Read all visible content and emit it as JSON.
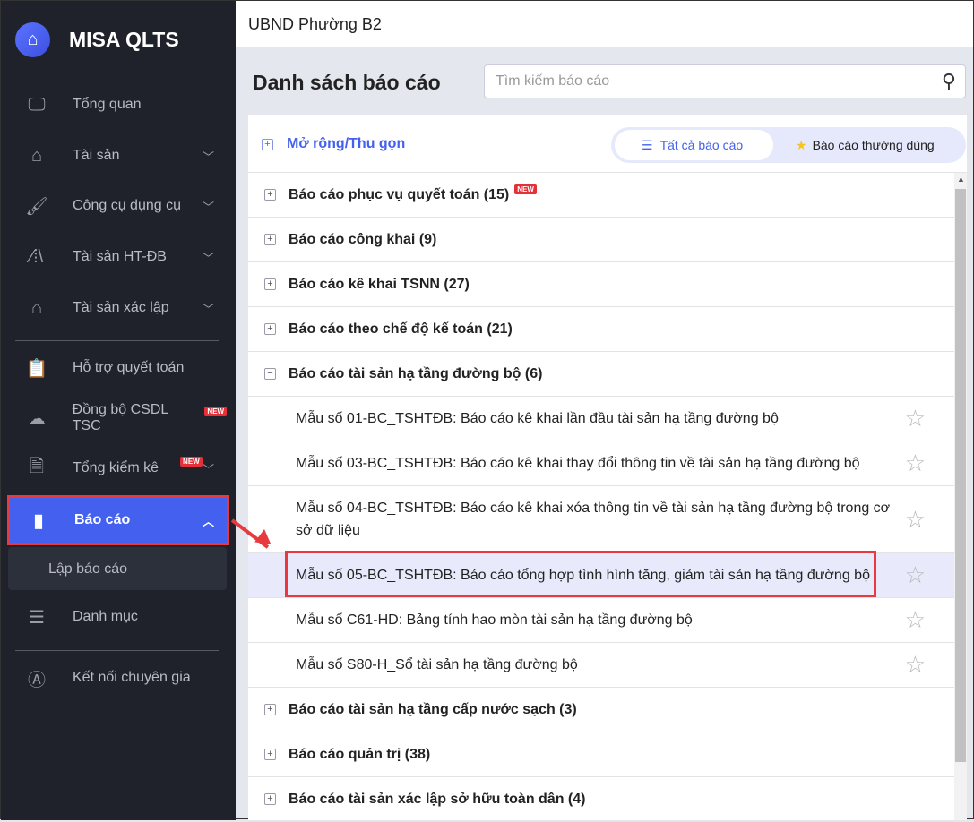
{
  "app": {
    "title": "MISA QLTS"
  },
  "sidebar": {
    "items": [
      {
        "label": "Tổng quan",
        "icon": "monitor-chart-icon"
      },
      {
        "label": "Tài sản",
        "icon": "house-car-icon"
      },
      {
        "label": "Công cụ dụng cụ",
        "icon": "paint-roller-icon"
      },
      {
        "label": "Tài sản HT-ĐB",
        "icon": "road-icon"
      },
      {
        "label": "Tài sản xác lập",
        "icon": "house-car-icon"
      },
      {
        "label": "Hỗ trợ quyết toán",
        "icon": "clipboard-check-icon"
      },
      {
        "label": "Đồng bộ CSDL TSC",
        "icon": "cloud-upload-icon",
        "badge": "NEW"
      },
      {
        "label": "Tổng kiểm kê",
        "icon": "document-check-icon",
        "badge": "NEW"
      },
      {
        "label": "Báo cáo",
        "icon": "bar-chart-icon"
      },
      {
        "label": "Danh mục",
        "icon": "list-icon"
      },
      {
        "label": "Kết nối chuyên gia",
        "icon": "expert-icon"
      }
    ],
    "sub_item": "Lập báo cáo"
  },
  "header": {
    "unit": "UBND Phường B2"
  },
  "main": {
    "title": "Danh sách báo cáo",
    "search_placeholder": "Tìm kiếm báo cáo",
    "expand_label": "Mở rộng/Thu gọn",
    "tab_all": "Tất cả báo cáo",
    "tab_favorite": "Báo cáo thường dùng",
    "groups": [
      {
        "label": "Báo cáo phục vụ quyết toán (15)",
        "badge": "NEW"
      },
      {
        "label": "Báo cáo công khai (9)"
      },
      {
        "label": "Báo cáo kê khai TSNN (27)"
      },
      {
        "label": "Báo cáo theo chế độ kế toán (21)"
      },
      {
        "label": "Báo cáo tài sản hạ tầng đường bộ (6)"
      },
      {
        "label": "Báo cáo tài sản hạ tầng cấp nước sạch (3)"
      },
      {
        "label": "Báo cáo quản trị (38)"
      },
      {
        "label": "Báo cáo tài sản xác lập sở hữu toàn dân (4)"
      }
    ],
    "items": [
      "Mẫu số 01-BC_TSHTĐB: Báo cáo kê khai lần đầu tài sản hạ tầng đường bộ",
      "Mẫu số 03-BC_TSHTĐB: Báo cáo kê khai thay đổi thông tin về tài sản hạ tầng đường bộ",
      "Mẫu số 04-BC_TSHTĐB: Báo cáo kê khai xóa thông tin về tài sản hạ tầng đường bộ trong cơ sở dữ liệu",
      "Mẫu số 05-BC_TSHTĐB: Báo cáo tổng hợp tình hình tăng, giảm tài sản hạ tầng đường bộ",
      "Mẫu số C61-HD: Bảng tính hao mòn tài sản hạ tầng đường bộ",
      "Mẫu số S80-H_Sổ tài sản hạ tầng đường bộ"
    ]
  }
}
